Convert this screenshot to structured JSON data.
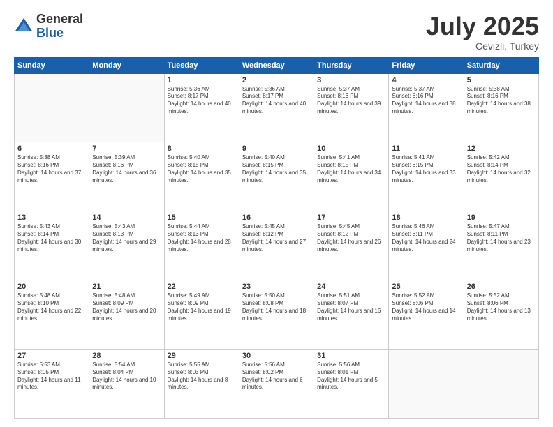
{
  "logo": {
    "general": "General",
    "blue": "Blue"
  },
  "title": "July 2025",
  "location": "Cevizli, Turkey",
  "days": [
    "Sunday",
    "Monday",
    "Tuesday",
    "Wednesday",
    "Thursday",
    "Friday",
    "Saturday"
  ],
  "weeks": [
    [
      {
        "num": "",
        "info": ""
      },
      {
        "num": "",
        "info": ""
      },
      {
        "num": "1",
        "info": "Sunrise: 5:36 AM\nSunset: 8:17 PM\nDaylight: 14 hours and 40 minutes."
      },
      {
        "num": "2",
        "info": "Sunrise: 5:36 AM\nSunset: 8:17 PM\nDaylight: 14 hours and 40 minutes."
      },
      {
        "num": "3",
        "info": "Sunrise: 5:37 AM\nSunset: 8:16 PM\nDaylight: 14 hours and 39 minutes."
      },
      {
        "num": "4",
        "info": "Sunrise: 5:37 AM\nSunset: 8:16 PM\nDaylight: 14 hours and 38 minutes."
      },
      {
        "num": "5",
        "info": "Sunrise: 5:38 AM\nSunset: 8:16 PM\nDaylight: 14 hours and 38 minutes."
      }
    ],
    [
      {
        "num": "6",
        "info": "Sunrise: 5:38 AM\nSunset: 8:16 PM\nDaylight: 14 hours and 37 minutes."
      },
      {
        "num": "7",
        "info": "Sunrise: 5:39 AM\nSunset: 8:16 PM\nDaylight: 14 hours and 36 minutes."
      },
      {
        "num": "8",
        "info": "Sunrise: 5:40 AM\nSunset: 8:15 PM\nDaylight: 14 hours and 35 minutes."
      },
      {
        "num": "9",
        "info": "Sunrise: 5:40 AM\nSunset: 8:15 PM\nDaylight: 14 hours and 35 minutes."
      },
      {
        "num": "10",
        "info": "Sunrise: 5:41 AM\nSunset: 8:15 PM\nDaylight: 14 hours and 34 minutes."
      },
      {
        "num": "11",
        "info": "Sunrise: 5:41 AM\nSunset: 8:15 PM\nDaylight: 14 hours and 33 minutes."
      },
      {
        "num": "12",
        "info": "Sunrise: 5:42 AM\nSunset: 8:14 PM\nDaylight: 14 hours and 32 minutes."
      }
    ],
    [
      {
        "num": "13",
        "info": "Sunrise: 5:43 AM\nSunset: 8:14 PM\nDaylight: 14 hours and 30 minutes."
      },
      {
        "num": "14",
        "info": "Sunrise: 5:43 AM\nSunset: 8:13 PM\nDaylight: 14 hours and 29 minutes."
      },
      {
        "num": "15",
        "info": "Sunrise: 5:44 AM\nSunset: 8:13 PM\nDaylight: 14 hours and 28 minutes."
      },
      {
        "num": "16",
        "info": "Sunrise: 5:45 AM\nSunset: 8:12 PM\nDaylight: 14 hours and 27 minutes."
      },
      {
        "num": "17",
        "info": "Sunrise: 5:45 AM\nSunset: 8:12 PM\nDaylight: 14 hours and 26 minutes."
      },
      {
        "num": "18",
        "info": "Sunrise: 5:46 AM\nSunset: 8:11 PM\nDaylight: 14 hours and 24 minutes."
      },
      {
        "num": "19",
        "info": "Sunrise: 5:47 AM\nSunset: 8:11 PM\nDaylight: 14 hours and 23 minutes."
      }
    ],
    [
      {
        "num": "20",
        "info": "Sunrise: 5:48 AM\nSunset: 8:10 PM\nDaylight: 14 hours and 22 minutes."
      },
      {
        "num": "21",
        "info": "Sunrise: 5:48 AM\nSunset: 8:09 PM\nDaylight: 14 hours and 20 minutes."
      },
      {
        "num": "22",
        "info": "Sunrise: 5:49 AM\nSunset: 8:09 PM\nDaylight: 14 hours and 19 minutes."
      },
      {
        "num": "23",
        "info": "Sunrise: 5:50 AM\nSunset: 8:08 PM\nDaylight: 14 hours and 18 minutes."
      },
      {
        "num": "24",
        "info": "Sunrise: 5:51 AM\nSunset: 8:07 PM\nDaylight: 14 hours and 16 minutes."
      },
      {
        "num": "25",
        "info": "Sunrise: 5:52 AM\nSunset: 8:06 PM\nDaylight: 14 hours and 14 minutes."
      },
      {
        "num": "26",
        "info": "Sunrise: 5:52 AM\nSunset: 8:06 PM\nDaylight: 14 hours and 13 minutes."
      }
    ],
    [
      {
        "num": "27",
        "info": "Sunrise: 5:53 AM\nSunset: 8:05 PM\nDaylight: 14 hours and 11 minutes."
      },
      {
        "num": "28",
        "info": "Sunrise: 5:54 AM\nSunset: 8:04 PM\nDaylight: 14 hours and 10 minutes."
      },
      {
        "num": "29",
        "info": "Sunrise: 5:55 AM\nSunset: 8:03 PM\nDaylight: 14 hours and 8 minutes."
      },
      {
        "num": "30",
        "info": "Sunrise: 5:56 AM\nSunset: 8:02 PM\nDaylight: 14 hours and 6 minutes."
      },
      {
        "num": "31",
        "info": "Sunrise: 5:56 AM\nSunset: 8:01 PM\nDaylight: 14 hours and 5 minutes."
      },
      {
        "num": "",
        "info": ""
      },
      {
        "num": "",
        "info": ""
      }
    ]
  ]
}
